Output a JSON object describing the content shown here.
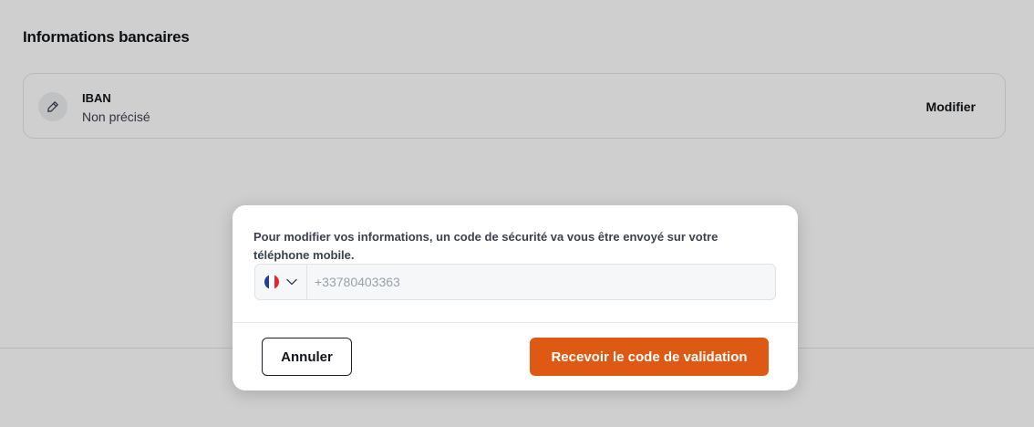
{
  "section": {
    "title": "Informations bancaires"
  },
  "iban": {
    "label": "IBAN",
    "value": "Non précisé",
    "icon": "pencil-icon",
    "action_label": "Modifier"
  },
  "modal": {
    "message": "Pour modifier vos informations, un code de sécurité va vous être envoyé sur votre téléphone mobile.",
    "phone": {
      "country_flag": "france-flag-icon",
      "dropdown_icon": "chevron-down-icon",
      "placeholder": "+33780403363"
    },
    "cancel_label": "Annuler",
    "submit_label": "Recevoir le code de validation"
  },
  "colors": {
    "primary": "#de5a14",
    "flag_blue": "#1f3f9a",
    "flag_white": "#ffffff",
    "flag_red": "#e4262e"
  }
}
